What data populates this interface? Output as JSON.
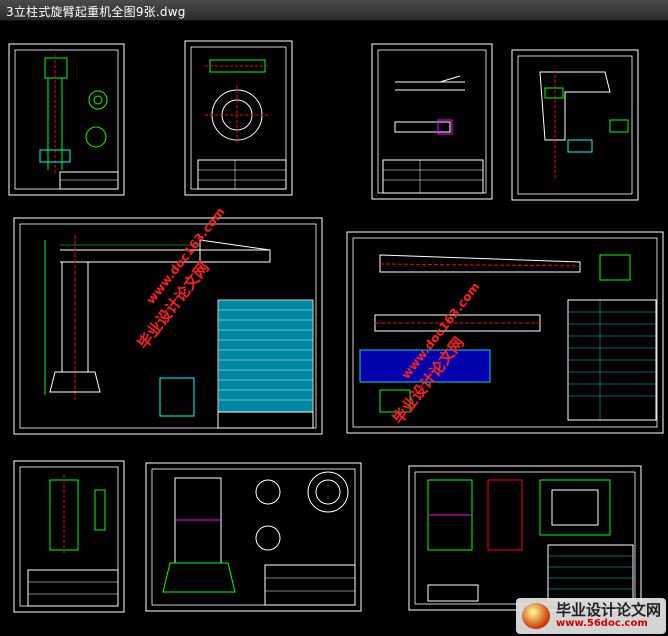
{
  "window": {
    "title": "3立柱式旋臂起重机全图9张.dwg"
  },
  "watermarks": [
    {
      "cn": "毕业设计论文网",
      "url": "www.doc163.com"
    },
    {
      "cn": "毕业设计论文网",
      "url": "www.doc163.com"
    }
  ],
  "logo": {
    "cn": "毕业设计论文网",
    "url": "www.56doc.com"
  },
  "colors": {
    "background": "#000000",
    "frame": "#ffffff",
    "part_green": "#00ff00",
    "part_cyan": "#00ffff",
    "part_red": "#ff0000",
    "part_magenta": "#ff00ff",
    "watermark": "#ff1e1e"
  },
  "sheets": [
    {
      "name": "sheet-1-column"
    },
    {
      "name": "sheet-2-flange"
    },
    {
      "name": "sheet-3-pin"
    },
    {
      "name": "sheet-4-bracket"
    },
    {
      "name": "sheet-5-assembly"
    },
    {
      "name": "sheet-6-jib-arm"
    },
    {
      "name": "sheet-7-plate"
    },
    {
      "name": "sheet-8-base"
    },
    {
      "name": "sheet-9-frame"
    }
  ]
}
